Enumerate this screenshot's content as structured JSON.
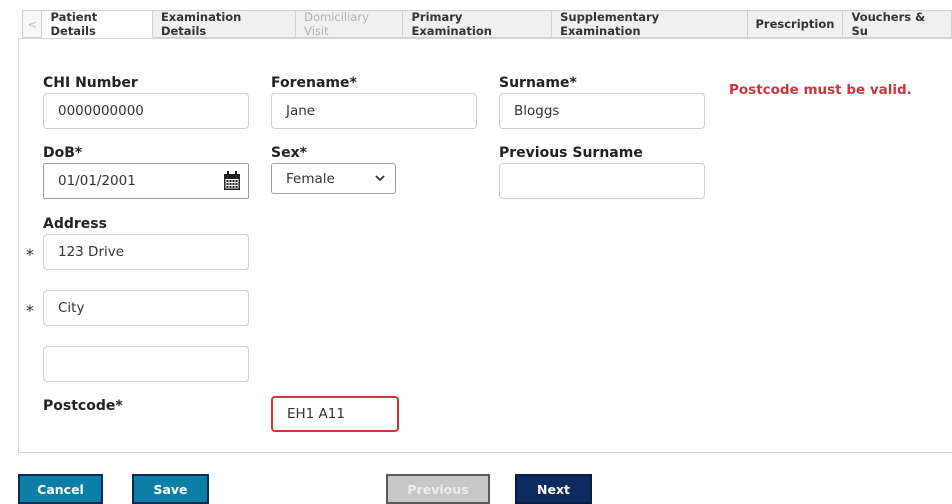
{
  "tabs": {
    "scroll_left": "<",
    "items": [
      {
        "label": "Patient Details"
      },
      {
        "label": "Examination Details"
      },
      {
        "label": "Domiciliary Visit"
      },
      {
        "label": "Primary Examination"
      },
      {
        "label": "Supplementary Examination"
      },
      {
        "label": "Prescription"
      },
      {
        "label": "Vouchers & Su"
      }
    ]
  },
  "form": {
    "chi": {
      "label": "CHI Number",
      "value": "0000000000"
    },
    "forename": {
      "label": "Forename*",
      "value": "Jane"
    },
    "surname": {
      "label": "Surname*",
      "value": "Bloggs"
    },
    "error": "Postcode must be valid.",
    "dob": {
      "label": "DoB*",
      "value": "01/01/2001",
      "icon": "calendar-icon"
    },
    "sex": {
      "label": "Sex*",
      "value": "Female",
      "icon": "chevron-down-icon"
    },
    "previous_surname": {
      "label": "Previous Surname",
      "value": ""
    },
    "address": {
      "label": "Address",
      "required_marker": "*",
      "line1": "123 Drive",
      "line2": "City",
      "line3": ""
    },
    "postcode": {
      "label": "Postcode*",
      "value": "EH1 A11"
    }
  },
  "buttons": {
    "cancel": "Cancel",
    "save": "Save",
    "previous": "Previous",
    "next": "Next"
  },
  "colors": {
    "error": "#d0343a",
    "primary_button": "#0d7fa6",
    "next_button": "#0e2a5e",
    "disabled_button": "#c7c7c7"
  }
}
